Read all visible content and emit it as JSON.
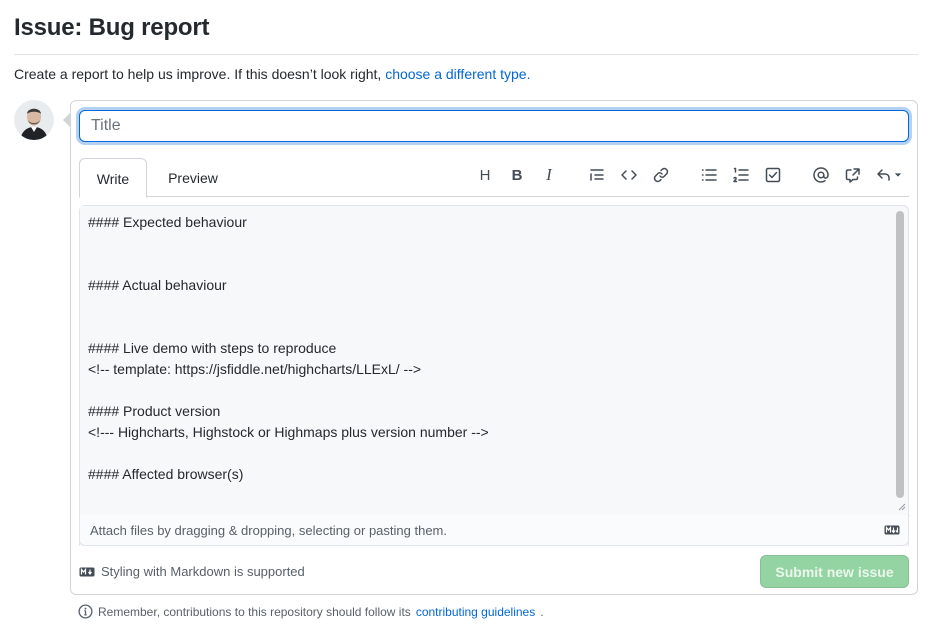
{
  "page": {
    "title": "Issue: Bug report",
    "intro_text": "Create a report to help us improve. If this doesn’t look right, ",
    "intro_link": "choose a different type.",
    "accent_color": "#0366d6",
    "submit_color": "#94d3a2"
  },
  "form": {
    "title_placeholder": "Title",
    "title_value": "",
    "tabs": [
      {
        "label": "Write",
        "active": true
      },
      {
        "label": "Preview",
        "active": false
      }
    ],
    "toolbar": [
      {
        "name": "heading-icon",
        "glyph": "H"
      },
      {
        "name": "bold-icon",
        "glyph": "B"
      },
      {
        "name": "italic-icon",
        "glyph": "I"
      },
      {
        "name": "quote-icon"
      },
      {
        "name": "code-icon"
      },
      {
        "name": "link-icon"
      },
      {
        "name": "unordered-list-icon"
      },
      {
        "name": "ordered-list-icon"
      },
      {
        "name": "task-list-icon"
      },
      {
        "name": "mention-icon"
      },
      {
        "name": "cross-reference-icon"
      },
      {
        "name": "reply-icon"
      }
    ],
    "body_text": "#### Expected behaviour\n\n\n#### Actual behaviour\n\n\n#### Live demo with steps to reproduce\n<!-- template: https://jsfiddle.net/highcharts/LLExL/ -->\n\n#### Product version\n<!--- Highcharts, Highstock or Highmaps plus version number -->\n\n#### Affected browser(s)",
    "attach_text": "Attach files by dragging & dropping, selecting or pasting them.",
    "markdown_note": "Styling with Markdown is supported",
    "submit_label": "Submit new issue"
  },
  "footer": {
    "text": "Remember, contributions to this repository should follow its ",
    "link": "contributing guidelines",
    "suffix": "."
  }
}
